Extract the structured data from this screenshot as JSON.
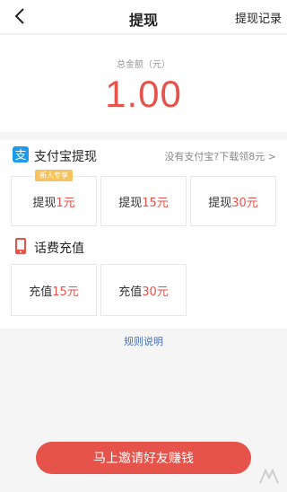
{
  "header": {
    "title": "提现",
    "record_label": "提现记录"
  },
  "amount": {
    "label": "总金额（元）",
    "value": "1.00"
  },
  "alipay": {
    "title": "支付宝提现",
    "link": "没有支付宝?下载领8元 >",
    "options": [
      {
        "prefix": "提现",
        "amount": "1元",
        "badge": "新人专享"
      },
      {
        "prefix": "提现",
        "amount": "15元"
      },
      {
        "prefix": "提现",
        "amount": "30元"
      }
    ]
  },
  "phone": {
    "title": "话费充值",
    "options": [
      {
        "prefix": "充值",
        "amount": "15元"
      },
      {
        "prefix": "充值",
        "amount": "30元"
      }
    ]
  },
  "rules_label": "规则说明",
  "invite_label": "马上邀请好友赚钱",
  "colors": {
    "accent": "#e5534b",
    "alipay_blue": "#1e9be8",
    "badge": "#f6c35c",
    "link": "#4a6fb5"
  },
  "icons": {
    "back": "back-arrow-icon",
    "alipay": "alipay-icon",
    "phone": "phone-icon",
    "watermark": "watermark-icon"
  }
}
